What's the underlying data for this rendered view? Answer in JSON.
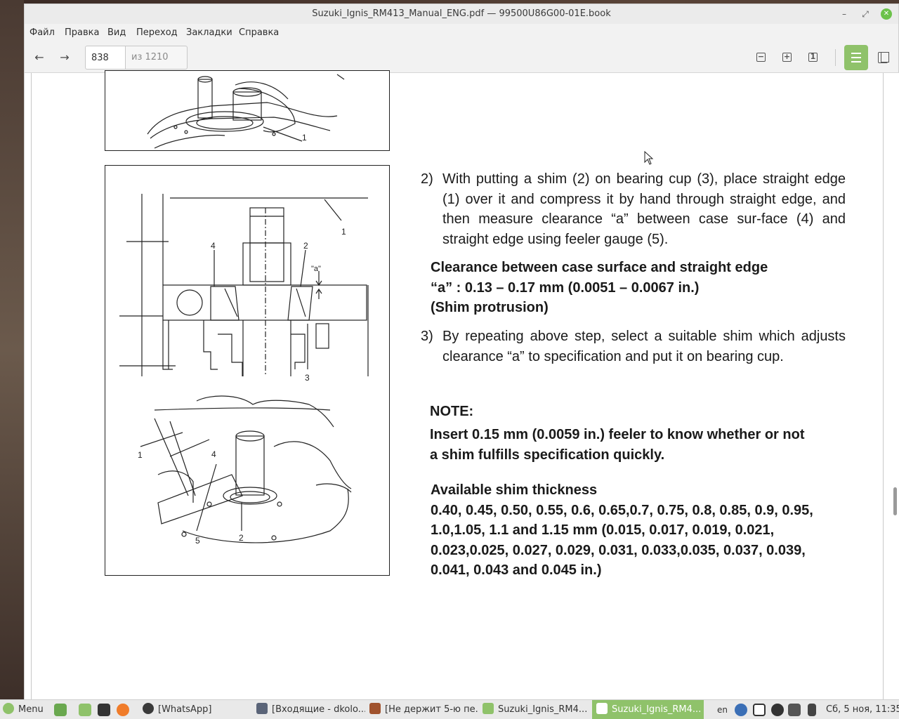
{
  "window": {
    "title": "Suzuki_Ignis_RM413_Manual_ENG.pdf — 99500U86G00-01E.book",
    "minimize": "–",
    "maximize": "⤢",
    "close": "✕"
  },
  "menu": {
    "file": "Файл",
    "edit": "Правка",
    "view": "Вид",
    "go": "Переход",
    "bookmarks": "Закладки",
    "help": "Справка"
  },
  "toolbar": {
    "back_icon": "←",
    "forward_icon": "→",
    "page_value": "838",
    "page_total": "из 1210",
    "zoom_out": "−",
    "zoom_in": "+",
    "zoom_fit": "1"
  },
  "document": {
    "fig_top_label_1": "1",
    "fig_main_labels": {
      "l1": "1",
      "l2": "2",
      "l3": "3",
      "l4": "4",
      "la": "\"a\"",
      "l1b": "1",
      "l4b": "4",
      "l5": "5",
      "l2b": "2"
    },
    "step2_num": "2)",
    "step2_text": "With putting a shim (2) on bearing cup (3), place straight edge (1) over it and compress it by hand through straight edge, and then measure clearance “a” between case sur-face (4) and straight edge using feeler gauge (5).",
    "spec_line1": "Clearance between case surface and straight edge",
    "spec_line2": "“a” : 0.13 – 0.17 mm (0.0051 – 0.0067 in.)",
    "spec_line3": "(Shim protrusion)",
    "step3_num": "3)",
    "step3_text": "By repeating above step, select a suitable shim which adjusts clearance “a” to specification and put it on bearing cup.",
    "note_title": "NOTE:",
    "note_line1": "Insert 0.15 mm (0.0059 in.) feeler to know whether or not",
    "note_line2": "a shim fulfills specification quickly.",
    "shim_title": "Available shim thickness",
    "shim_line1": "0.40, 0.45, 0.50, 0.55, 0.6, 0.65,0.7, 0.75, 0.8, 0.85, 0.9, 0.95,",
    "shim_line2": "1.0,1.05, 1.1 and 1.15 mm (0.015, 0.017, 0.019, 0.021,",
    "shim_line3": "0.023,0.025, 0.027, 0.029, 0.031, 0.033,0.035, 0.037, 0.039,",
    "shim_line4": "0.041, 0.043 and 0.045 in.)"
  },
  "taskbar": {
    "menu": "Menu",
    "whatsapp": "[WhatsApp]",
    "mail": "[Входящие - dkolo...",
    "browser": "[Не держит 5-ю пе...",
    "folder": "Suzuki_Ignis_RM4...",
    "viewer": "Suzuki_Ignis_RM4...",
    "lang": "en",
    "clock": "Сб, 5 ноя, 11:35"
  },
  "colors": {
    "accent": "#8fc26a",
    "close": "#6cc24a"
  }
}
